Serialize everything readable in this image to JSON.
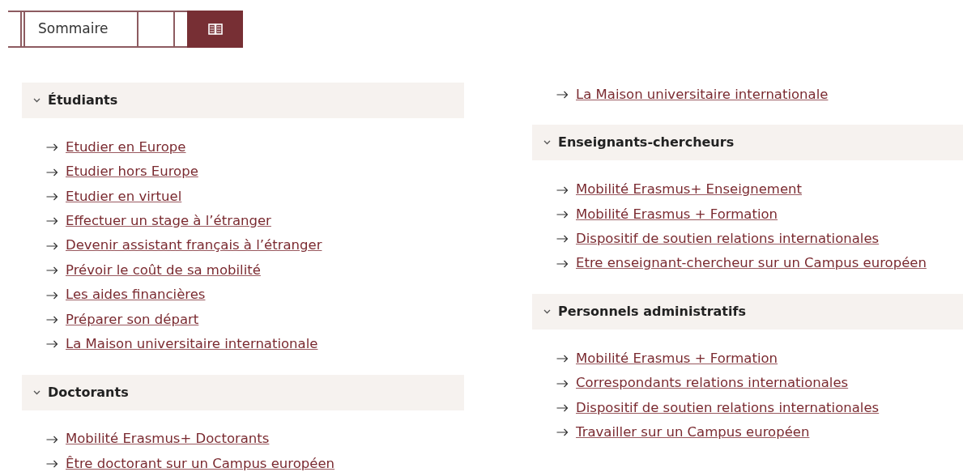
{
  "toolbar": {
    "tab_label": "Sommaire",
    "book_button_selected": true
  },
  "columns": [
    {
      "blocks": [
        {
          "heading": "Étudiants",
          "expanded": true,
          "links": [
            "Etudier en Europe",
            "Etudier hors Europe",
            "Etudier en virtuel",
            "Effectuer un stage à l’étranger",
            "Devenir assistant français à l’étranger",
            "Prévoir le coût de sa mobilité",
            "Les aides financières",
            "Préparer son départ",
            "La Maison universitaire internationale"
          ]
        },
        {
          "heading": "Doctorants",
          "expanded": true,
          "links": [
            "Mobilité Erasmus+ Doctorants",
            "Être doctorant sur un Campus européen"
          ]
        }
      ]
    },
    {
      "blocks": [
        {
          "links": [
            "La Maison universitaire internationale"
          ]
        },
        {
          "heading": "Enseignants-chercheurs",
          "expanded": true,
          "links": [
            "Mobilité Erasmus+ Enseignement",
            "Mobilité Erasmus + Formation",
            "Dispositif de soutien relations internationales",
            "Etre enseignant-chercheur sur un Campus européen"
          ]
        },
        {
          "heading": "Personnels administratifs",
          "expanded": true,
          "links": [
            "Mobilité Erasmus + Formation",
            "Correspondants relations internationales",
            "Dispositif de soutien relations internationales",
            "Travailler sur un Campus européen"
          ]
        }
      ]
    }
  ]
}
